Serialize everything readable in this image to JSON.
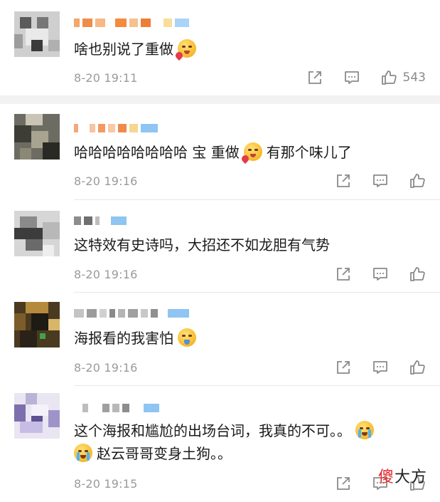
{
  "comments": [
    {
      "content": "啥也别说了重做",
      "emoji_after": "blush-heart-emoji",
      "time": "8-20 19:11",
      "like_count": "543"
    },
    {
      "content_a": "哈哈哈哈哈哈哈哈 宝 重做",
      "emoji_mid": "blush-heart-emoji",
      "content_b": "有那个味儿了",
      "time": "8-20 19:16"
    },
    {
      "content": "这特效有史诗吗，大招还不如龙胆有气势",
      "time": "8-20 19:16"
    },
    {
      "content": "海报看的我害怕",
      "emoji_after": "scared-emoji",
      "time": "8-20 19:16"
    },
    {
      "content_line1": "这个海报和尴尬的出场台词，我真的不可。。",
      "content_line2": "赵云哥哥变身土狗。。",
      "emoji": "crying-emoji",
      "time": "8-20 19:15"
    }
  ],
  "watermark": {
    "part1": "傻",
    "part2": "大方"
  },
  "colors": {
    "time": "#9a9a9a",
    "divider": "#f2f2f2",
    "icon": "#8a8a8a"
  }
}
